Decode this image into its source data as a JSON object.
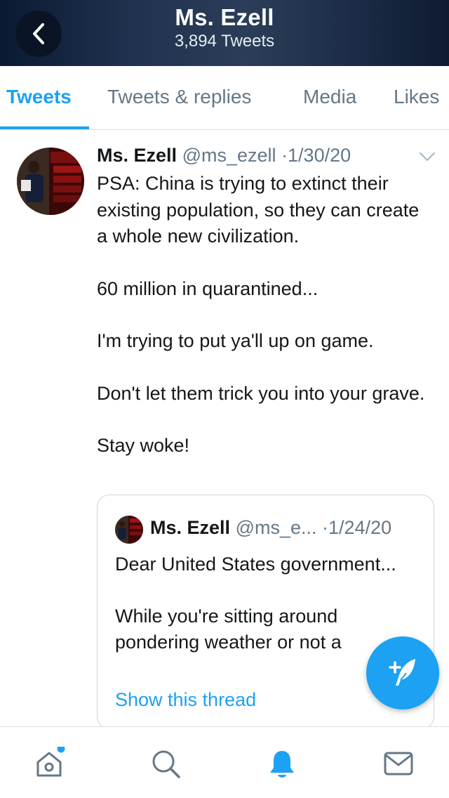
{
  "header": {
    "title": "Ms. Ezell",
    "subtitle": "3,894 Tweets"
  },
  "tabs": [
    {
      "label": "Tweets",
      "active": true
    },
    {
      "label": "Tweets & replies",
      "active": false
    },
    {
      "label": "Media",
      "active": false
    },
    {
      "label": "Likes",
      "active": false
    }
  ],
  "tweet": {
    "name": "Ms. Ezell",
    "handle": "@ms_ezell",
    "separator": "·",
    "date": "1/30/20",
    "text_lines": [
      "PSA: China is trying to extinct their existing population, so they can create a whole new civilization.",
      "60 million in quarantined...",
      "I'm trying to put ya'll up on game.",
      "Don't let them trick you into your grave.",
      "Stay woke!"
    ],
    "quote": {
      "name": "Ms. Ezell",
      "handle": "@ms_e...",
      "separator": "·",
      "date": "1/24/20",
      "text_lines": [
        "Dear United States government...",
        "While you're sitting around pondering weather or not a"
      ],
      "link": "Show this thread"
    }
  },
  "icons": {
    "back": "back-chevron-icon",
    "caret": "chevron-down-icon",
    "compose": "compose-tweet-icon",
    "home": "home-icon",
    "search": "search-icon",
    "notifications": "bell-icon",
    "messages": "mail-icon"
  },
  "colors": {
    "accent": "#1da1f2",
    "text": "#14171a",
    "muted": "#657786",
    "border": "#ccd6dd"
  }
}
